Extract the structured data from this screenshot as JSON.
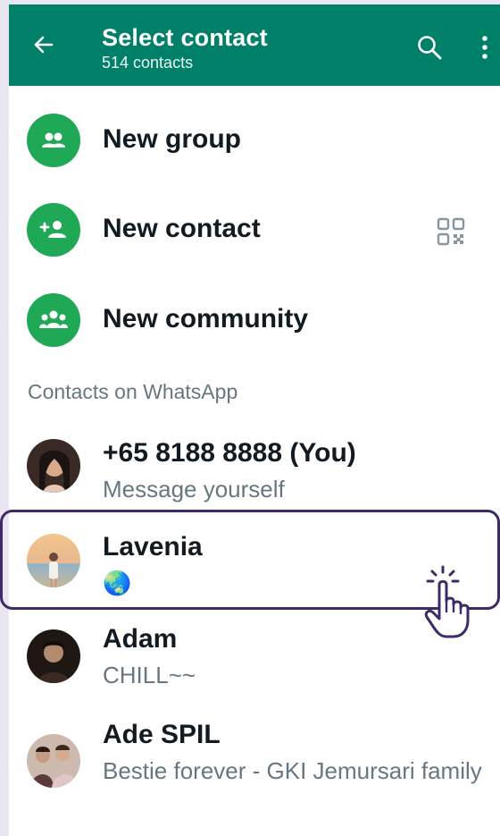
{
  "header": {
    "title": "Select contact",
    "subtitle": "514 contacts",
    "back_icon": "arrow-left-icon",
    "search_icon": "search-icon",
    "more_icon": "more-vertical-icon",
    "bar_color": "#008069"
  },
  "actions": [
    {
      "label": "New group",
      "icon": "group-icon"
    },
    {
      "label": "New contact",
      "icon": "add-person-icon",
      "trailing_icon": "qr-code-icon"
    },
    {
      "label": "New community",
      "icon": "community-icon"
    }
  ],
  "section_header": "Contacts on WhatsApp",
  "contacts": [
    {
      "name": "+65 8188 8888 (You)",
      "status": "Message yourself"
    },
    {
      "name": "Lavenia",
      "status": "🌏"
    },
    {
      "name": "Adam",
      "status": "CHILL~~"
    },
    {
      "name": "Ade SPIL",
      "status": "Bestie forever - GKI Jemursari family"
    }
  ],
  "colors": {
    "accent_green": "#1fa855",
    "highlight_outline": "#3d2a67"
  }
}
